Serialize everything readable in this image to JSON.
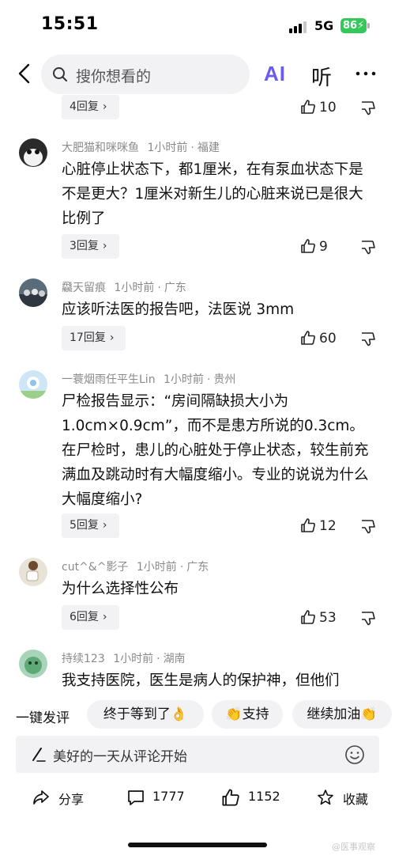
{
  "status_bar": {
    "time": "15:51",
    "network": "5G",
    "battery": "86"
  },
  "header": {
    "search_placeholder": "搜你想看的",
    "ai_label": "AI",
    "listen_label": "听"
  },
  "comments": [
    {
      "reply_label": "4回复",
      "likes": "10"
    },
    {
      "user": "大肥猫和咪咪鱼",
      "time": "1小时前",
      "location": "福建",
      "text": "心脏停止状态下，都1厘米，在有泵血状态下是不是更大？1厘米对新生儿的心脏来说已是很大比例了",
      "reply_label": "3回复",
      "likes": "9"
    },
    {
      "user": "飝天留痕",
      "time": "1小时前",
      "location": "广东",
      "text": "应该听法医的报告吧，法医说 3mm",
      "reply_label": "17回复",
      "likes": "60"
    },
    {
      "user": "一蓑烟雨任平生Lin",
      "time": "1小时前",
      "location": "贵州",
      "text": "尸检报告显示：“房间隔缺损大小为1.0cm×0.9cm”，而不是患方所说的0.3cm。在尸检时，患儿的心脏处于停止状态，较生前充满血及跳动时有大幅度缩小。专业的说说为什么大幅度缩小?",
      "reply_label": "5回复",
      "likes": "12"
    },
    {
      "user": "cut^&^影子",
      "time": "1小时前",
      "location": "广东",
      "text": "为什么选择性公布",
      "reply_label": "6回复",
      "likes": "53"
    },
    {
      "user": "持续123",
      "time": "1小时前",
      "location": "湖南",
      "text": "我支持医院，医生是病人的保护神，但他们"
    }
  ],
  "quick_reply": {
    "label": "一键发评",
    "chips": [
      "终于等到了",
      "支持",
      "继续加油"
    ]
  },
  "comment_input": {
    "placeholder": "美好的一天从评论开始"
  },
  "bottom_bar": {
    "share": "分享",
    "comments": "1777",
    "likes": "1152",
    "favorite": "收藏"
  },
  "watermark": "@医事观察"
}
